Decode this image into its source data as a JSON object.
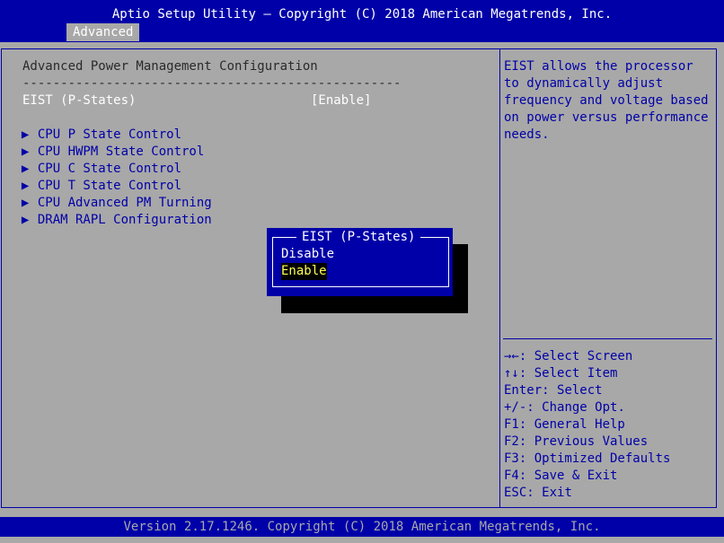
{
  "header": {
    "title": "Aptio Setup Utility – Copyright (C) 2018 American Megatrends, Inc.",
    "tab_label": "Advanced"
  },
  "main": {
    "section_title": "Advanced Power Management Configuration",
    "divider": "--------------------------------------------------",
    "setting_label": "EIST (P-States)",
    "setting_value": "[Enable]",
    "items": [
      {
        "label": "CPU P State Control"
      },
      {
        "label": "CPU HWPM State Control"
      },
      {
        "label": "CPU C State Control"
      },
      {
        "label": "CPU T State Control"
      },
      {
        "label": "CPU Advanced PM Turning"
      },
      {
        "label": "DRAM RAPL Configuration"
      }
    ]
  },
  "popup": {
    "title": "EIST (P-States)",
    "options": [
      "Disable",
      "Enable"
    ],
    "selected": "Enable"
  },
  "help": {
    "description_lines": [
      "EIST allows the processor",
      "to dynamically adjust",
      "frequency and voltage based",
      "on power versus performance",
      "needs."
    ],
    "keys": [
      {
        "key": "→←",
        "desc": ": Select Screen"
      },
      {
        "key": "↑↓",
        "desc": ": Select Item"
      },
      {
        "key": "Enter",
        "desc": ": Select"
      },
      {
        "key": "+/-",
        "desc": ": Change Opt."
      },
      {
        "key": "F1",
        "desc": ": General Help"
      },
      {
        "key": "F2",
        "desc": ": Previous Values"
      },
      {
        "key": "F3",
        "desc": ": Optimized Defaults"
      },
      {
        "key": "F4",
        "desc": ": Save & Exit"
      },
      {
        "key": "ESC",
        "desc": ": Exit"
      }
    ]
  },
  "footer": {
    "text": "Version 2.17.1246. Copyright (C) 2018 American Megatrends, Inc."
  },
  "colors": {
    "background": "#a8a8a8",
    "bios_blue": "#0000a8",
    "highlight_text": "#ffff54"
  }
}
